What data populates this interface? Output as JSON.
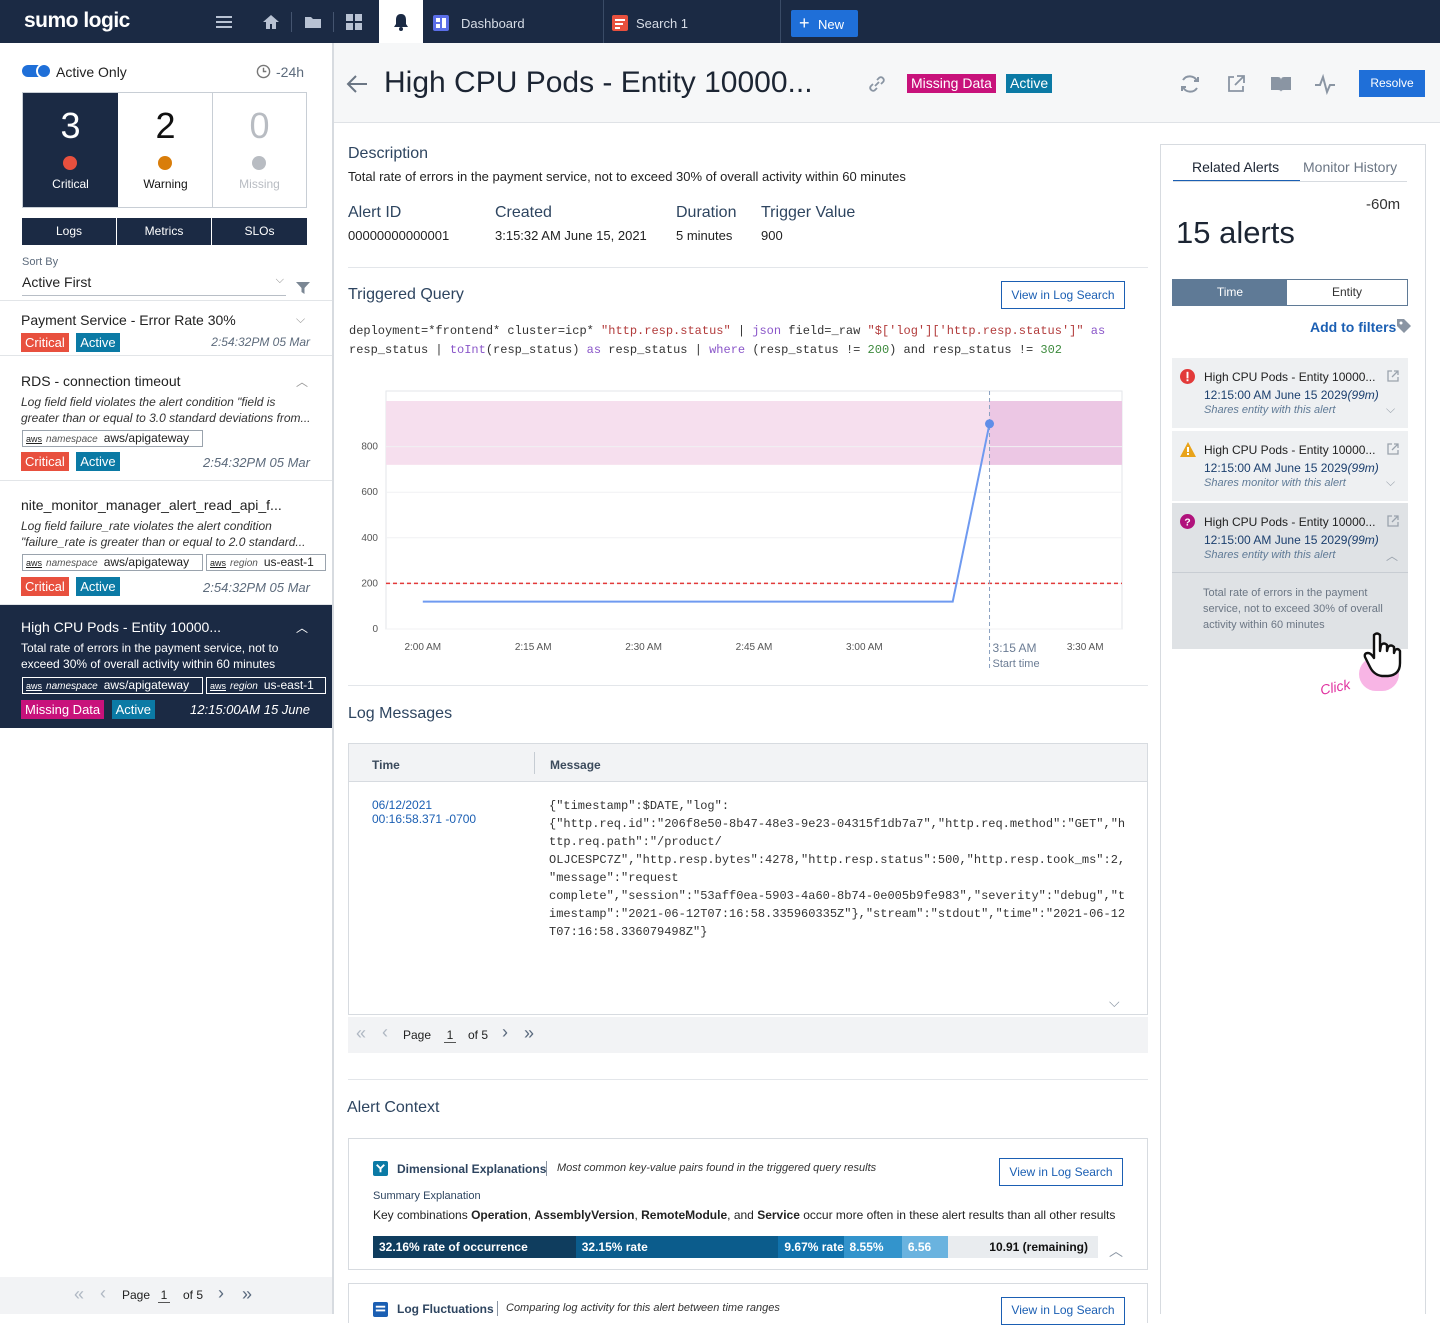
{
  "app": {
    "logo": "sumo logic",
    "tab_dashboard": "Dashboard",
    "tab_search": "Search 1",
    "new_label": "New"
  },
  "left": {
    "active_only": "Active Only",
    "range": "-24h",
    "counts": [
      {
        "n": "3",
        "label": "Critical",
        "color": "#e8503e"
      },
      {
        "n": "2",
        "label": "Warning",
        "color": "#d97d0a"
      },
      {
        "n": "0",
        "label": "Missing",
        "color": "#b8bcc2"
      }
    ],
    "types": [
      "Logs",
      "Metrics",
      "SLOs"
    ],
    "sort_by_label": "Sort By",
    "sort_value": "Active First",
    "alerts": [
      {
        "title": "Payment Service - Error Rate 30%",
        "sev": "Critical",
        "status": "Active",
        "time": "2:54:32PM 05 Mar"
      },
      {
        "title": "RDS - connection timeout",
        "desc": "Log field field violates the alert condition \"field is greater than or equal to 3.0 standard deviations from...",
        "ns_key": "namespace",
        "ns_val": "aws/apigateway",
        "sev": "Critical",
        "status": "Active",
        "time": "2:54:32PM  05 Mar"
      },
      {
        "title": "nite_monitor_manager_alert_read_api_f...",
        "desc": "Log field failure_rate violates the alert condition \"failure_rate is greater than or equal to 2.0 standard...",
        "ns_key": "namespace",
        "ns_val": "aws/apigateway",
        "rg_key": "region",
        "rg_val": "us-east-1",
        "sev": "Critical",
        "status": "Active",
        "time": "2:54:32PM  05 Mar"
      },
      {
        "title": "High CPU Pods - Entity 10000...",
        "desc": "Total rate of errors in the payment service, not to exceed 30% of overall activity within 60 minutes",
        "ns_key": "namespace",
        "ns_val": "aws/apigateway",
        "rg_key": "region",
        "rg_val": "us-east-1",
        "sev": "Missing Data",
        "status": "Active",
        "time": "12:15:00AM  15 June"
      }
    ],
    "pager": {
      "page": "Page",
      "num": "1",
      "of": "of 5"
    },
    "aws": "aws"
  },
  "detail": {
    "title": "High CPU Pods - Entity 10000...",
    "badge1": "Missing Data",
    "badge2": "Active",
    "resolve": "Resolve",
    "desc_h": "Description",
    "desc": "Total rate of errors in the payment service, not to exceed 30% of overall activity within 60 minutes",
    "fields": [
      {
        "k": "Alert ID",
        "v": "00000000000001"
      },
      {
        "k": "Created",
        "v": "3:15:32 AM June 15, 2021"
      },
      {
        "k": "Duration",
        "v": "5 minutes"
      },
      {
        "k": "Trigger Value",
        "v": "900"
      }
    ],
    "tq_h": "Triggered Query",
    "view_log": "View in Log Search",
    "q1a": "deployment=*frontend* cluster=icp* ",
    "q1b": "\"http.resp.status\"",
    "q1c": " | ",
    "q1d": "json",
    "q1e": " field=_raw ",
    "q1f": "\"$['log']['http.resp.status']\"",
    "q1g": " as",
    "q2a": "resp_status | ",
    "q2b": "toInt",
    "q2c": "(resp_status) ",
    "q2d": "as",
    "q2e": " resp_status | ",
    "q2f": "where",
    "q2g": " (resp_status != ",
    "q2h": "200",
    "q2i": ") and resp_status != ",
    "q2j": "302",
    "lm_h": "Log Messages",
    "lm_time_h": "Time",
    "lm_msg_h": "Message",
    "lm_date": "06/12/2021",
    "lm_time": "00:16:58.371 -0700",
    "lm_msg": "{\"timestamp\":$DATE,\"log\":\n{\"http.req.id\":\"206f8e50-8b47-48e3-9e23-04315f1db7a7\",\"http.req.method\":\"GET\",\"h\nttp.req.path\":\"/product/\nOLJCESPC7Z\",\"http.resp.bytes\":4278,\"http.resp.status\":500,\"http.resp.took_ms\":2,\n\"message\":\"request\ncomplete\",\"session\":\"53aff0ea-5903-4a60-8b74-0e005b9fe983\",\"severity\":\"debug\",\"t\nimestamp\":\"2021-06-12T07:16:58.335960335Z\"},\"stream\":\"stdout\",\"time\":\"2021-06-12\nT07:16:58.336079498Z\"}",
    "lm_pager": {
      "page": "Page",
      "num": "1",
      "of": "of 5"
    },
    "ac_h": "Alert Context",
    "de_h": "Dimensional Explanations",
    "de_sub": "Most common key-value pairs found in the triggered query results",
    "summary_h": "Summary Explanation",
    "sum_a": "Key combinations ",
    "sum_b": "Operation",
    "sum_c": ", ",
    "sum_d": "AssemblyVersion",
    "sum_e": ", ",
    "sum_f": "RemoteModule",
    "sum_g": ", and ",
    "sum_h": "Service",
    "sum_i": " occur more often in these alert results than all other results",
    "bars": [
      {
        "label": "32.16% rate of occurrence",
        "color": "#0f3d5e",
        "frac": 0.3216
      },
      {
        "label": "32.15% rate",
        "color": "#0b5c8c",
        "frac": 0.3215
      },
      {
        "label": "9.67% rate",
        "color": "#1172ac",
        "frac": 0.0967
      },
      {
        "label": "8.55%",
        "color": "#3394cc",
        "frac": 0.0855
      },
      {
        "label": "6.56",
        "color": "#6ab3df",
        "frac": 0.0656
      },
      {
        "label": "10.91 (remaining)",
        "color": "#e9ecef",
        "frac": 0.2191
      }
    ],
    "lf_h": "Log Fluctuations",
    "lf_sub": "Comparing log activity for this alert between time ranges"
  },
  "chart_data": {
    "type": "line",
    "x": [
      "2:00 AM",
      "2:15 AM",
      "2:30 AM",
      "2:45 AM",
      "3:00 AM",
      "3:15 AM",
      "3:30 AM"
    ],
    "y_ticks": [
      0,
      200,
      400,
      600,
      800
    ],
    "ylim": [
      0,
      1000
    ],
    "xlim_minutes": [
      -5,
      95
    ],
    "series": [
      {
        "points": [
          [
            0,
            120
          ],
          [
            72,
            120
          ],
          [
            77,
            900
          ]
        ]
      }
    ],
    "threshold": 200,
    "start_time_label": "3:15 AM",
    "start_time_caption": "Start time",
    "start_time_minutes": 77
  },
  "related": {
    "tab1": "Related Alerts",
    "tab2": "Monitor History",
    "range": "-60m",
    "count": "15 alerts",
    "toggle1": "Time",
    "toggle2": "Entity",
    "add_filters": "Add to filters",
    "items": [
      {
        "title": "High CPU Pods - Entity 10000...",
        "time": "12:15:00 AM  June 15 2029",
        "dur": "(99m)",
        "note": "Shares entity with this alert",
        "icon": "error-icon"
      },
      {
        "title": "High CPU Pods - Entity 10000...",
        "time": "12:15:00 AM  June 15 2029",
        "dur": "(99m)",
        "note": "Shares monitor with this alert",
        "icon": "warning-icon"
      },
      {
        "title": "High CPU Pods - Entity 10000...",
        "time": "12:15:00 AM  June 15 2029",
        "dur": "(99m)",
        "note": "Shares entity with this alert",
        "icon": "question-icon"
      }
    ],
    "expanded_desc": "Total rate of errors in the payment service, not to exceed 30% of overall activity within 60 minutes",
    "click": "Click"
  }
}
